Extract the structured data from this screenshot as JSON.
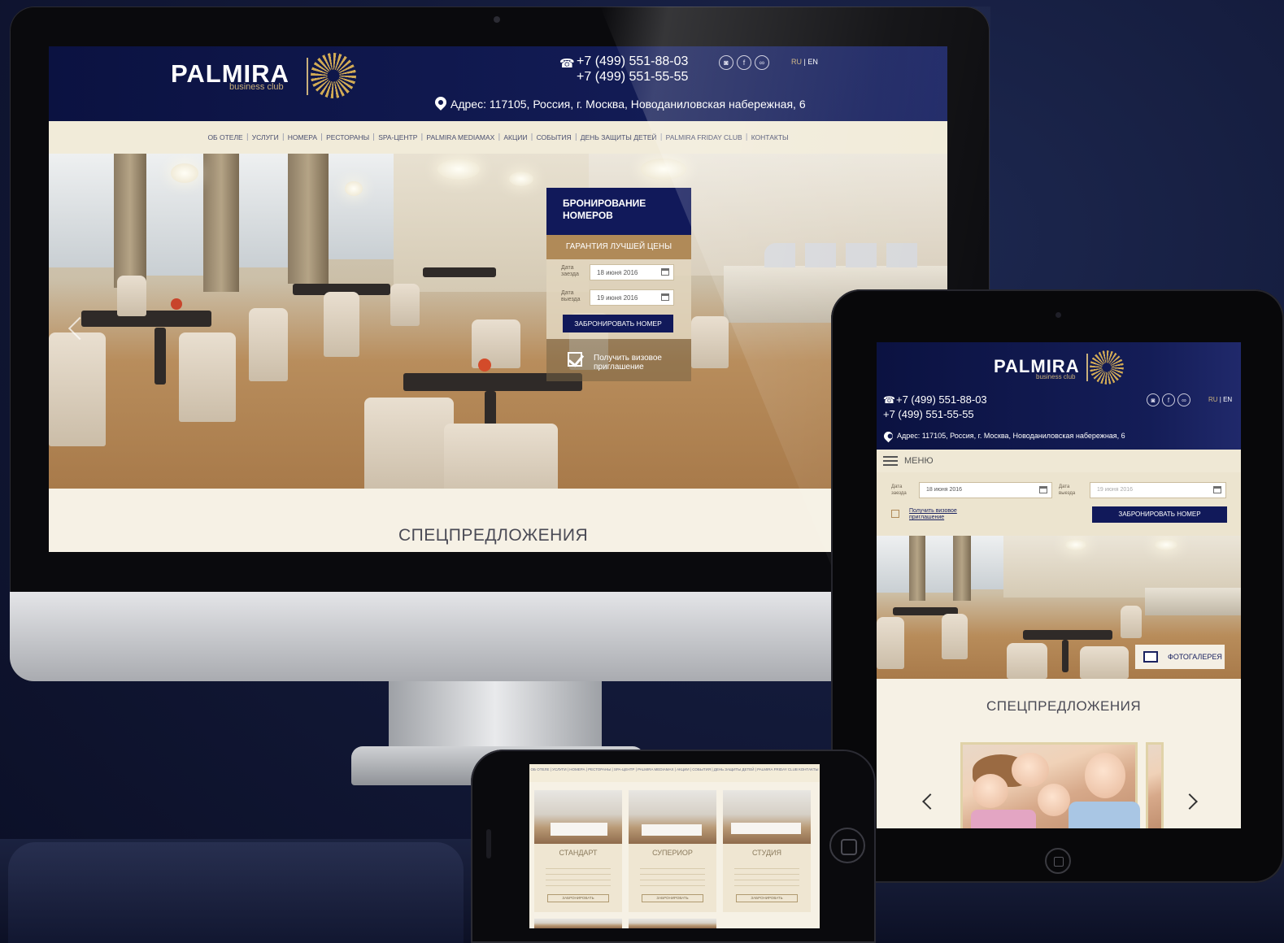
{
  "brand": {
    "logo_text": "PALMIRA",
    "logo_sub": "business club"
  },
  "contacts": {
    "phone_1": "+7 (499) 551-88-03",
    "phone_2": "+7 (499) 551-55-55",
    "address": "Адрес: 117105, Россия, г. Москва, Новоданиловская набережная, 6"
  },
  "lang": {
    "ru": "RU",
    "en": "EN"
  },
  "social": [
    "instagram-icon",
    "facebook-icon",
    "tripadvisor-icon"
  ],
  "nav": [
    "ОБ ОТЕЛЕ",
    "УСЛУГИ",
    "НОМЕРА",
    "РЕСТОРАНЫ",
    "SPA-ЦЕНТР",
    "PALMIRA MEDIAMAX",
    "АКЦИИ",
    "СОБЫТИЯ",
    "ДЕНЬ ЗАЩИТЫ ДЕТЕЙ",
    "PALMIRA FRIDAY CLUB",
    "КОНТАКТЫ"
  ],
  "booking": {
    "title": "БРОНИРОВАНИЕ НОМЕРОВ",
    "guarantee": "ГАРАНТИЯ ЛУЧШЕЙ ЦЕНЫ",
    "arrival_label": "Дата заезда",
    "arrival_value": "18 июня 2016",
    "departure_label": "Дата выезда",
    "departure_value": "19 июня 2016",
    "button": "ЗАБРОНИРОВАТЬ НОМЕР",
    "visa": "Получить визовое приглашение"
  },
  "special_offers": "СПЕЦПРЕДЛОЖЕНИЯ",
  "tablet": {
    "menu_label": "МЕНЮ",
    "gallery": "ФОТОГАЛЕРЕЯ"
  },
  "phone": {
    "rooms": [
      {
        "name": "СТАНДАРТ",
        "button": "ЗАБРОНИРОВАТЬ"
      },
      {
        "name": "СУПЕРИОР",
        "button": "ЗАБРОНИРОВАТЬ"
      },
      {
        "name": "СТУДИЯ",
        "button": "ЗАБРОНИРОВАТЬ"
      }
    ]
  },
  "colors": {
    "navy": "#0b1241",
    "gold": "#b08a58",
    "cream": "#f4efe2"
  }
}
